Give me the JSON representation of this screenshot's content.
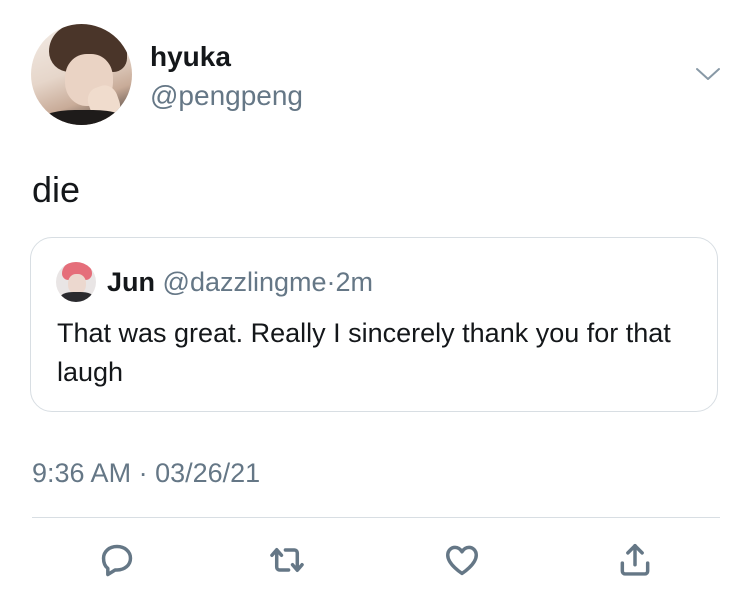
{
  "author": {
    "name": "hyuka",
    "handle": "@pengpeng"
  },
  "tweet": {
    "text": "die",
    "time": "9:36 AM",
    "separator": "·",
    "date": "03/26/21"
  },
  "quoted_tweet": {
    "name": "Jun",
    "handle": "@dazzlingme",
    "separator": "·",
    "time": "2m",
    "text": "That was great. Really I sincerely thank you for that laugh"
  },
  "icons": {
    "menu": "chevron-down-icon",
    "reply": "reply-icon",
    "retweet": "retweet-icon",
    "like": "heart-icon",
    "share": "share-icon"
  },
  "colors": {
    "text": "#14171a",
    "secondary": "#657786",
    "border": "#d8dee3"
  }
}
